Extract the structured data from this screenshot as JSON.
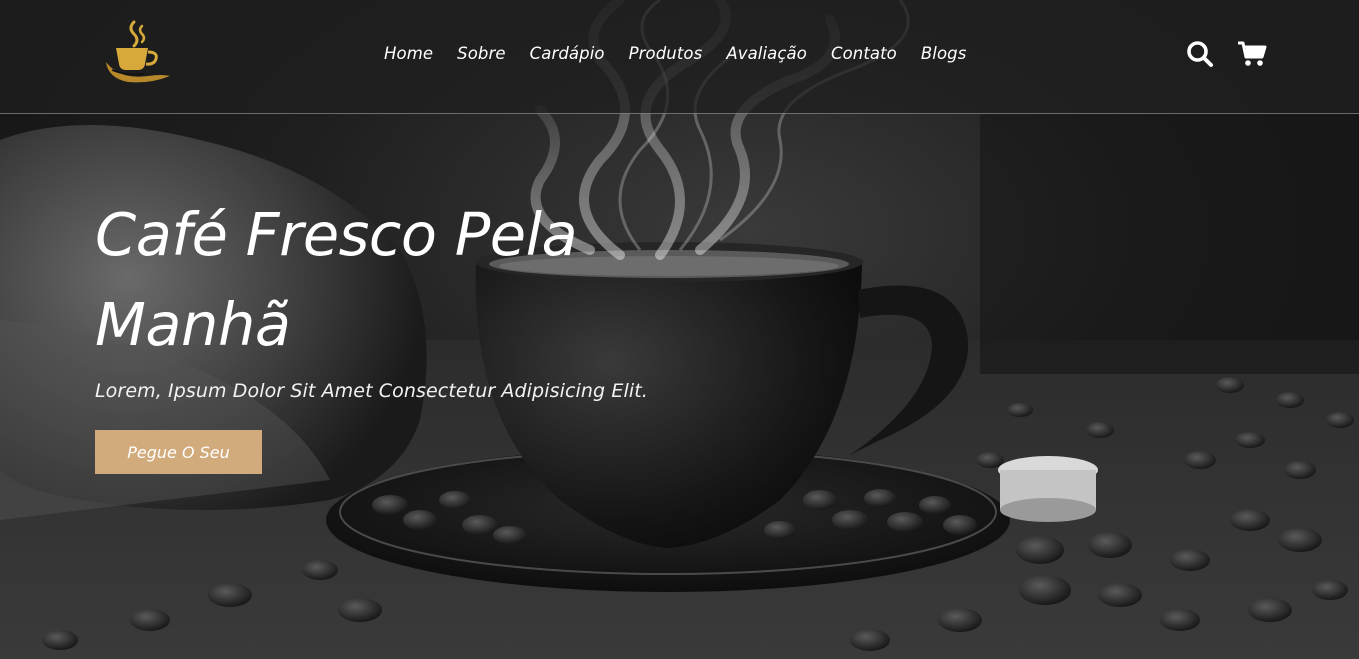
{
  "header": {
    "logo_icon": "coffee-cup-logo-icon",
    "nav": [
      {
        "label": "Home"
      },
      {
        "label": "Sobre"
      },
      {
        "label": "Cardápio"
      },
      {
        "label": "Produtos"
      },
      {
        "label": "Avaliação"
      },
      {
        "label": "Contato"
      },
      {
        "label": "Blogs"
      }
    ],
    "search_icon": "search-icon",
    "cart_icon": "cart-icon"
  },
  "hero": {
    "title_line1": "Café Fresco Pela",
    "title_line2": "Manhã",
    "subtitle": "Lorem, Ipsum Dolor Sit Amet Consectetur Adipisicing Elit.",
    "cta_label": "Pegue O Seu"
  },
  "colors": {
    "accent": "#d2ab7c",
    "logo_gold": "#d6a93a",
    "header_bg": "#1e1e1e",
    "text": "#ffffff"
  }
}
